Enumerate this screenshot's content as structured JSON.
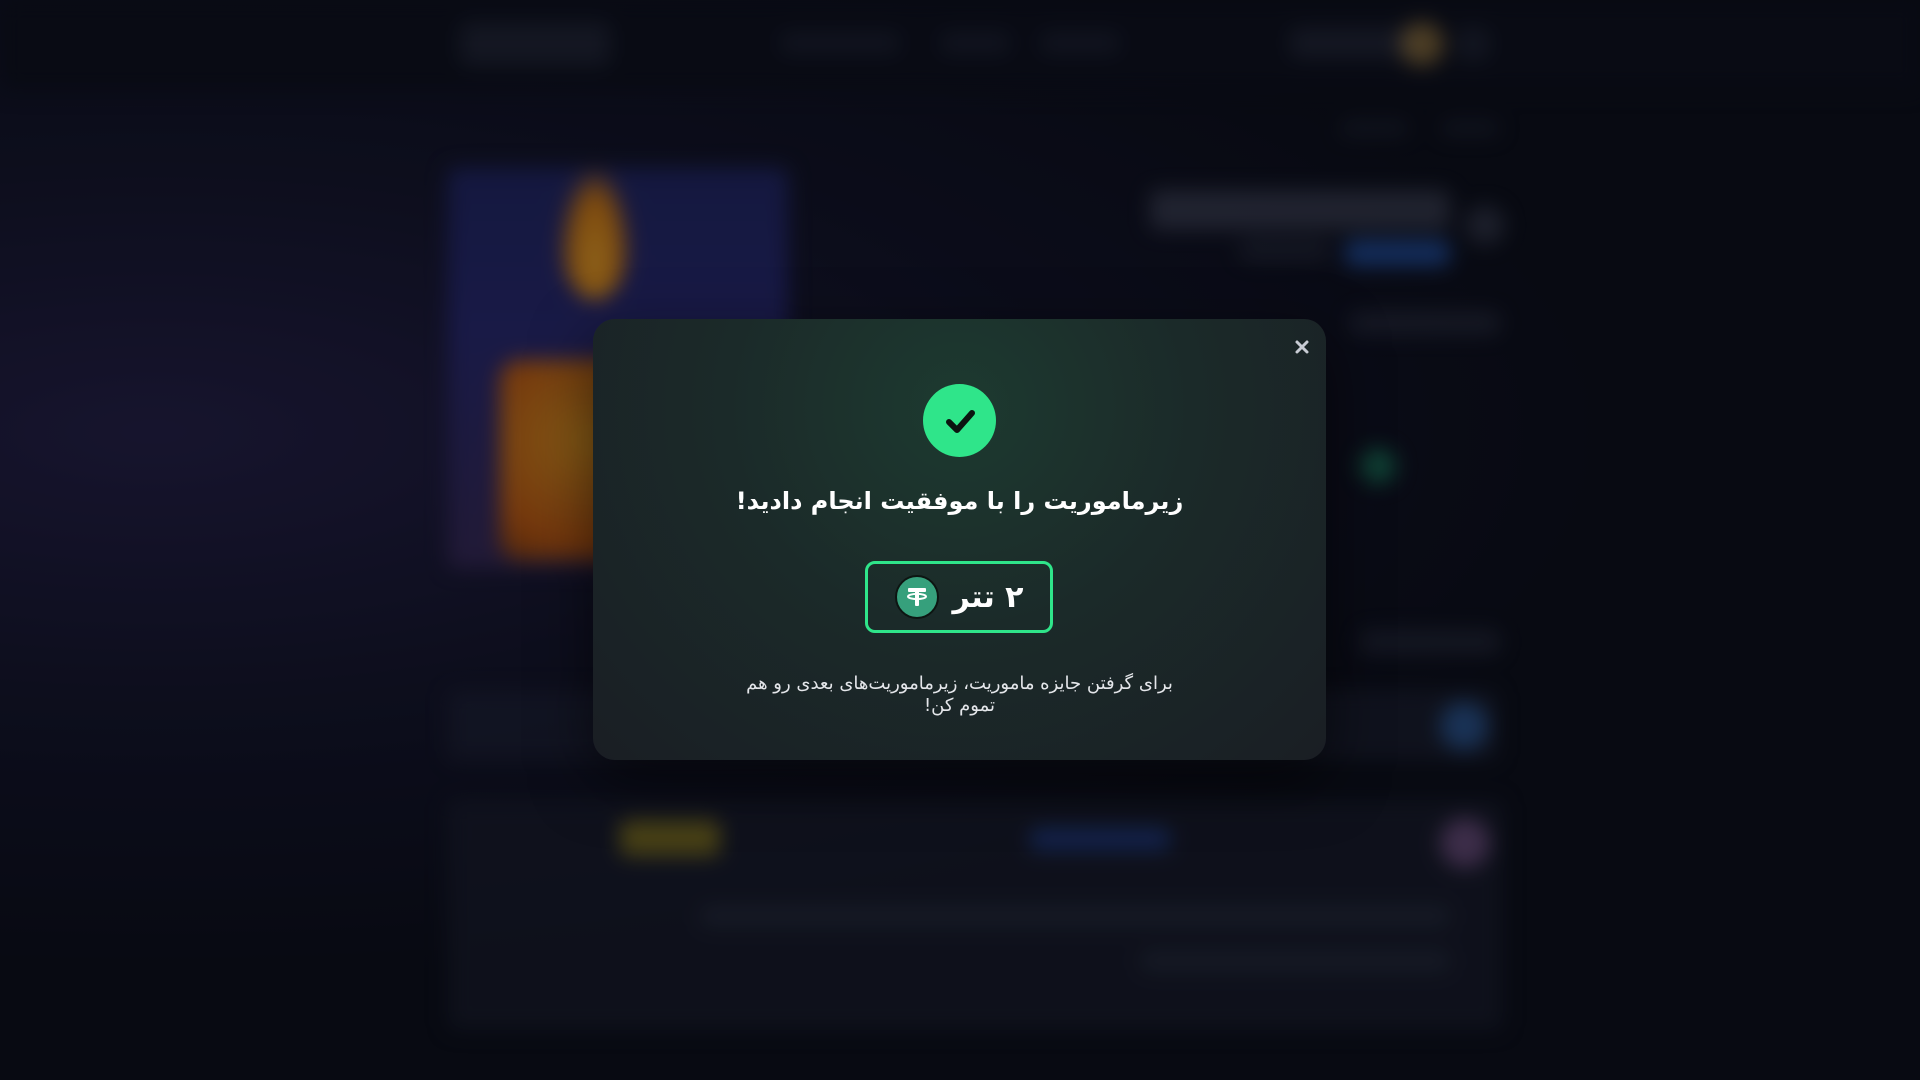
{
  "modal": {
    "title": "زیرماموریت را با موفقیت انجام دادید!",
    "reward": {
      "amount_label": "۲ تتر",
      "currency_icon": "tether-icon"
    },
    "description": "برای گرفتن جایزه ماموریت، زیرماموریت‌های بعدی رو هم تموم کن!",
    "close_label": "×",
    "status_icon": "checkmark-icon"
  },
  "colors": {
    "accent": "#2fe58a",
    "tether": "#36a07c",
    "modal_bg": "#1b2a29",
    "text": "#ffffff"
  }
}
